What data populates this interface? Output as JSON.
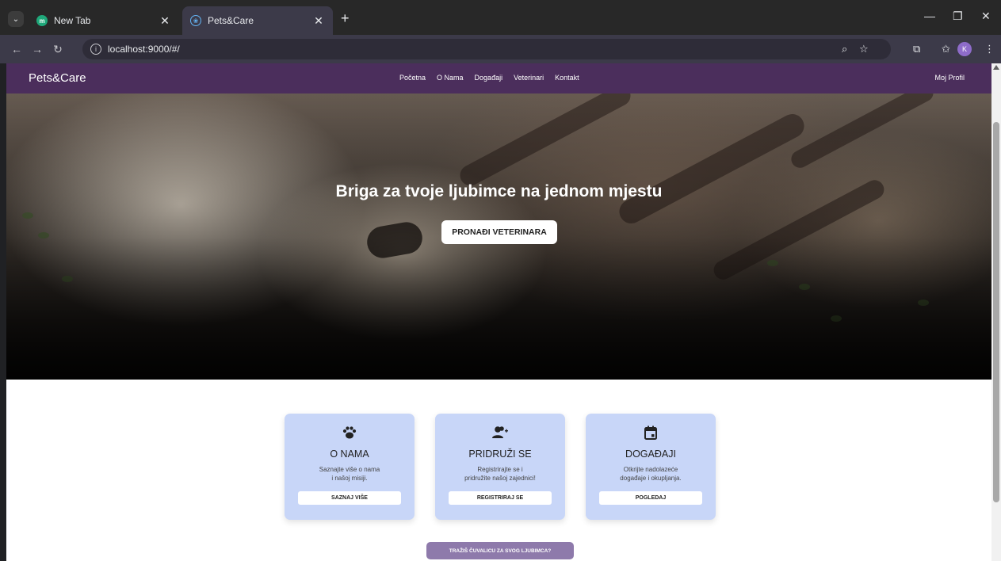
{
  "browser": {
    "tabs": [
      {
        "title": "New Tab",
        "favicon": "m",
        "active": false
      },
      {
        "title": "Pets&Care",
        "favicon": "",
        "active": true
      }
    ],
    "new_tab_symbol": "+",
    "url": "localhost:9000/#/",
    "profile_initial": "K"
  },
  "site": {
    "logo": "Pets&Care",
    "nav": [
      "Početna",
      "O Nama",
      "Događaji",
      "Veterinari",
      "Kontakt"
    ],
    "profile_link": "Moj Profil"
  },
  "hero": {
    "title": "Briga za tvoje ljubimce na jednom mjestu",
    "button": "PRONAĐI VETERINARA"
  },
  "cards": [
    {
      "icon": "paw-icon",
      "title": "O NAMA",
      "text_1": "Saznajte više o nama",
      "text_2": "i našoj misiji.",
      "button": "SAZNAJ VIŠE"
    },
    {
      "icon": "add-user-icon",
      "title": "PRIDRUŽI SE",
      "text_1": "Registrirajte se i",
      "text_2": "pridružite našoj zajednici!",
      "button": "REGISTRIRAJ SE"
    },
    {
      "icon": "calendar-icon",
      "title": "DOGAĐAJI",
      "text_1": "Otkrijte nadolazeće",
      "text_2": "događaje i okupljanja.",
      "button": "POGLEDAJ"
    }
  ],
  "sitter_button": "TRAŽIŠ ČUVALICU ZA SVOG LJUBIMCA?",
  "colors": {
    "nav_bg": "#4b2e5c",
    "card_bg": "#c8d6f8",
    "sitter_btn": "#8e7aab"
  }
}
